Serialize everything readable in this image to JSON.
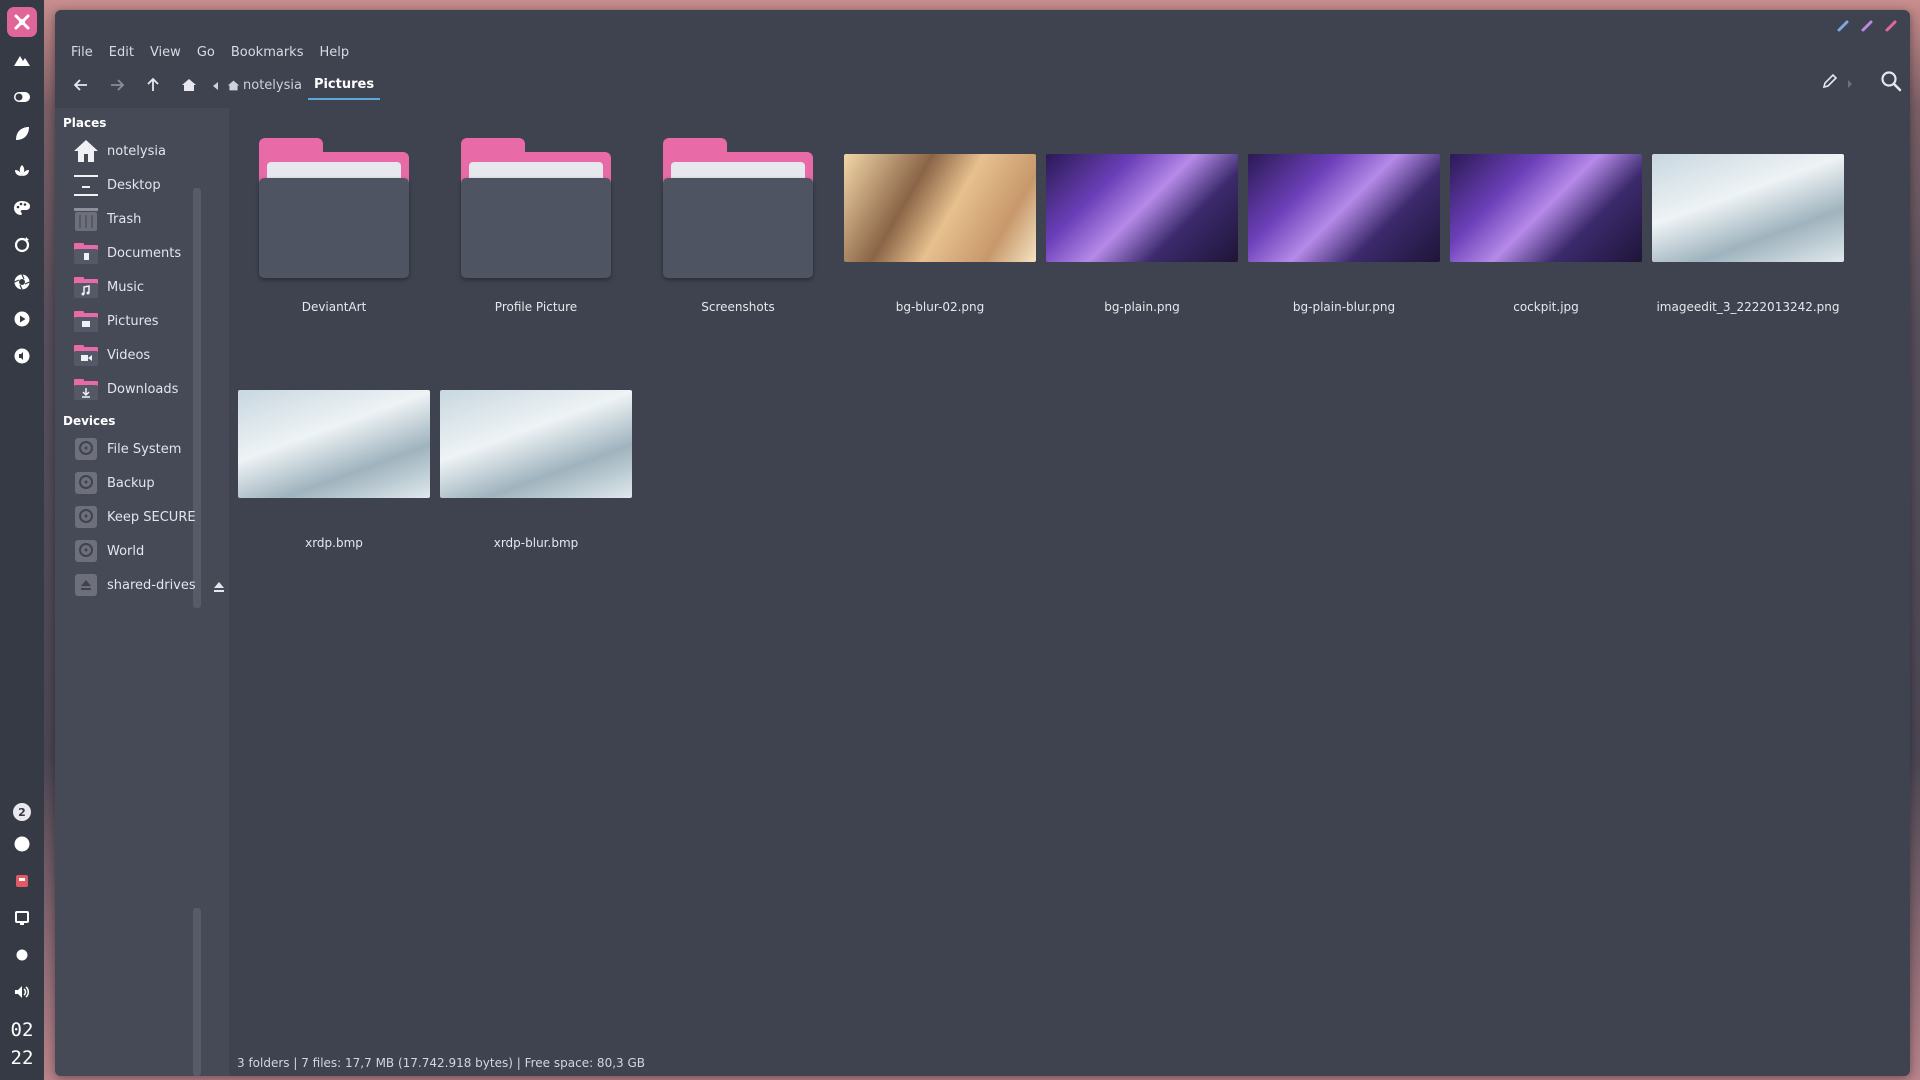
{
  "dock": {
    "icons": [
      "app-logo-icon",
      "mountain-icon",
      "toggle-icon",
      "leaf-icon",
      "lotus-icon",
      "palette-icon",
      "refresh-icon",
      "aperture-icon",
      "play-icon",
      "audio-icon"
    ],
    "workspace_number": "2",
    "clock_hour": "02",
    "clock_minute": "22"
  },
  "menubar": {
    "items": [
      "File",
      "Edit",
      "View",
      "Go",
      "Bookmarks",
      "Help"
    ]
  },
  "breadcrumb": {
    "home": "notelysia",
    "current": "Pictures"
  },
  "sidebar": {
    "places_title": "Places",
    "places": [
      {
        "label": "notelysia",
        "icon": "home-icon"
      },
      {
        "label": "Desktop",
        "icon": "desktop-icon"
      },
      {
        "label": "Trash",
        "icon": "trash-icon"
      },
      {
        "label": "Documents",
        "icon": "documents-folder-icon"
      },
      {
        "label": "Music",
        "icon": "music-folder-icon"
      },
      {
        "label": "Pictures",
        "icon": "pictures-folder-icon"
      },
      {
        "label": "Videos",
        "icon": "videos-folder-icon"
      },
      {
        "label": "Downloads",
        "icon": "downloads-folder-icon"
      }
    ],
    "devices_title": "Devices",
    "devices": [
      {
        "label": "File System",
        "icon": "drive-icon"
      },
      {
        "label": "Backup",
        "icon": "drive-icon"
      },
      {
        "label": "Keep SECURE",
        "icon": "drive-icon"
      },
      {
        "label": "World",
        "icon": "drive-icon"
      },
      {
        "label": "shared-drives",
        "icon": "network-drive-icon"
      }
    ]
  },
  "files": [
    {
      "name": "DeviantArt",
      "type": "folder"
    },
    {
      "name": "Profile Picture",
      "type": "folder"
    },
    {
      "name": "Screenshots",
      "type": "folder"
    },
    {
      "name": "bg-blur-02.png",
      "type": "image"
    },
    {
      "name": "bg-plain.png",
      "type": "image"
    },
    {
      "name": "bg-plain-blur.png",
      "type": "image"
    },
    {
      "name": "cockpit.jpg",
      "type": "image"
    },
    {
      "name": "imageedit_3_2222013242.png",
      "type": "image"
    },
    {
      "name": "xrdp.bmp",
      "type": "image"
    },
    {
      "name": "xrdp-blur.bmp",
      "type": "image"
    }
  ],
  "status": {
    "text": "3 folders  |  7 files: 17,7 MB (17.742.918 bytes)  |  Free space: 80,3 GB"
  },
  "colors": {
    "accent": "#e86aa6",
    "highlight": "#5aa7d8",
    "window_bg": "#3f434f",
    "sidebar_bg": "#464a57",
    "dock_bg": "#363a45"
  }
}
